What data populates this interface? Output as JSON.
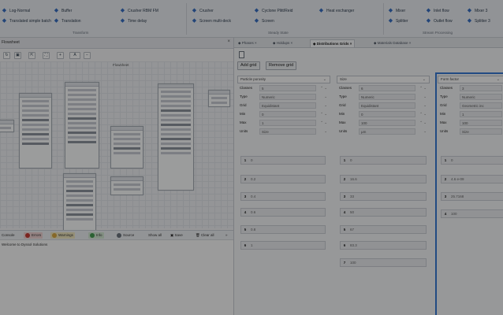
{
  "ribbon": {
    "items": [
      {
        "label": "Log-Normal",
        "icon": "distribution-icon"
      },
      {
        "label": "Translated simple batch",
        "icon": "distribution-icon"
      },
      {
        "label": "Buffer",
        "icon": "buffer-icon"
      },
      {
        "label": "Translation",
        "icon": "translate-icon"
      },
      {
        "label": "Crusher RBM FM",
        "icon": "crusher-icon"
      },
      {
        "label": "Time delay",
        "icon": "delay-icon"
      },
      {
        "label": "Crusher",
        "icon": "crusher-icon"
      },
      {
        "label": "Screen multi-deck",
        "icon": "screen-icon"
      },
      {
        "label": "Cyclone Plitt/Reid",
        "icon": "cyclone-icon"
      },
      {
        "label": "Screen",
        "icon": "screen-icon"
      },
      {
        "label": "Heat exchanger",
        "icon": "heat-exchanger-icon"
      },
      {
        "label": "Mixer",
        "icon": "mixer-icon"
      },
      {
        "label": "Splitter",
        "icon": "splitter-icon"
      },
      {
        "label": "Inlet flow",
        "icon": "inlet-icon"
      },
      {
        "label": "Outlet flow",
        "icon": "outlet-icon"
      },
      {
        "label": "Mixer 3",
        "icon": "mixer-icon"
      },
      {
        "label": "Splitter 3",
        "icon": "splitter-icon"
      }
    ],
    "groups": [
      "Transform",
      "Steady State",
      "Stream Processing"
    ]
  },
  "left": {
    "tab_title": "Flowsheet",
    "canvas_title": "Flowsheet",
    "console": {
      "title": "Console",
      "errors_label": "Errors",
      "warnings_label": "Warnings",
      "info_label": "Info",
      "source_label": "Source",
      "show_all_label": "Show all",
      "save_label": "Save",
      "clear_label": "Clear all",
      "message": "Welcome to Dyssol Solutions"
    }
  },
  "right": {
    "tabs": [
      "Phases",
      "Holdups",
      "Distributions Grids",
      "Materials Database"
    ],
    "active_tab": "Distributions Grids",
    "add_grid_label": "Add grid",
    "remove_grid_label": "Remove grid",
    "grids": [
      {
        "header": "Particle porosity",
        "props": [
          {
            "label": "Classes",
            "value": "5"
          },
          {
            "label": "Type",
            "value": "Numeric"
          },
          {
            "label": "Grid",
            "value": "Equidistant"
          },
          {
            "label": "Min",
            "value": "0"
          },
          {
            "label": "Max",
            "value": "1"
          },
          {
            "label": "Units",
            "value": "Size"
          }
        ],
        "values": [
          "0",
          "0.2",
          "0.4",
          "0.6",
          "0.8",
          "1"
        ]
      },
      {
        "header": "Size",
        "props": [
          {
            "label": "Classes",
            "value": "6"
          },
          {
            "label": "Type",
            "value": "Numeric"
          },
          {
            "label": "Grid",
            "value": "Equidistant"
          },
          {
            "label": "Min",
            "value": "0"
          },
          {
            "label": "Max",
            "value": "100"
          },
          {
            "label": "Units",
            "value": "μm"
          }
        ],
        "values": [
          "0",
          "16.6",
          "33",
          "50",
          "67",
          "83.3",
          "100"
        ]
      },
      {
        "header": "Form factor",
        "props": [
          {
            "label": "Classes",
            "value": "3"
          },
          {
            "label": "Type",
            "value": "Numeric"
          },
          {
            "label": "Grid",
            "value": "Geometric inc"
          },
          {
            "label": "Min",
            "value": "1"
          },
          {
            "label": "Max",
            "value": "100"
          },
          {
            "label": "Units",
            "value": "Size"
          }
        ],
        "values": [
          "0",
          "4.6 e-09",
          "25.7168",
          "100"
        ]
      }
    ]
  }
}
